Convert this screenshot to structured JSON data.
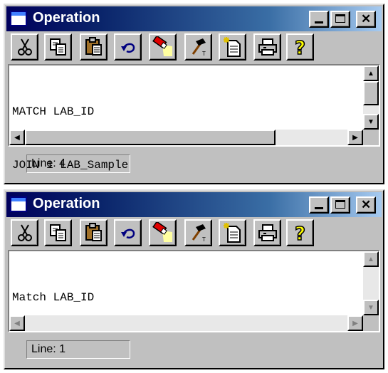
{
  "windows": [
    {
      "title": "Operation",
      "lines": [
        "MATCH LAB_ID",
        "JOIN 1 LAB_Sample"
      ],
      "status": "Line: 4",
      "scrollbars_enabled": true
    },
    {
      "title": "Operation",
      "lines": [
        "Match LAB_ID"
      ],
      "status": "Line: 1",
      "scrollbars_enabled": false
    }
  ],
  "toolbar": [
    "cut-icon",
    "copy-icon",
    "paste-icon",
    "undo-icon",
    "flashlight-icon",
    "hammer-icon",
    "new-document-icon",
    "print-icon",
    "help-icon"
  ],
  "colors": {
    "titlebar_start": "#00005c",
    "titlebar_end": "#a6caf0",
    "face": "#c0c0c0"
  }
}
